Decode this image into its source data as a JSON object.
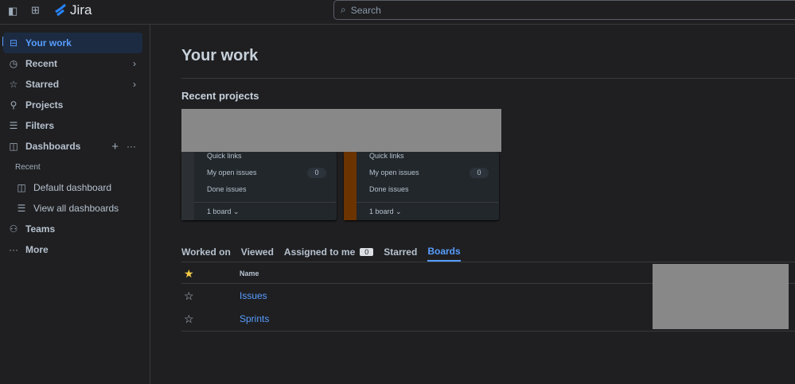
{
  "topbar": {
    "app_name": "Jira",
    "search_placeholder": "Search"
  },
  "sidebar": {
    "items": [
      {
        "label": "Your work",
        "icon": "inbox-icon"
      },
      {
        "label": "Recent",
        "icon": "clock-icon"
      },
      {
        "label": "Starred",
        "icon": "star-icon"
      },
      {
        "label": "Projects",
        "icon": "rocket-icon"
      },
      {
        "label": "Filters",
        "icon": "filter-icon"
      },
      {
        "label": "Dashboards",
        "icon": "dashboard-icon"
      }
    ],
    "recent_label": "Recent",
    "sub_items": [
      {
        "label": "Default dashboard"
      },
      {
        "label": "View all dashboards"
      }
    ],
    "bottom_items": [
      {
        "label": "Teams"
      },
      {
        "label": "More"
      }
    ]
  },
  "main": {
    "title": "Your work",
    "recent_projects": "Recent projects",
    "cards": [
      {
        "quick_links": "Quick links",
        "open_issues": "My open issues",
        "open_count": "0",
        "done": "Done issues",
        "boards": "1 board",
        "color": "#2c3034"
      },
      {
        "quick_links": "Quick links",
        "open_issues": "My open issues",
        "open_count": "0",
        "done": "Done issues",
        "boards": "1 board",
        "color": "#6b3300"
      }
    ],
    "tabs": [
      {
        "label": "Worked on"
      },
      {
        "label": "Viewed"
      },
      {
        "label": "Assigned to me",
        "badge": "0"
      },
      {
        "label": "Starred"
      },
      {
        "label": "Boards"
      }
    ],
    "table": {
      "header": "Name",
      "rows": [
        {
          "name": "Issues"
        },
        {
          "name": "Sprints"
        }
      ]
    }
  }
}
